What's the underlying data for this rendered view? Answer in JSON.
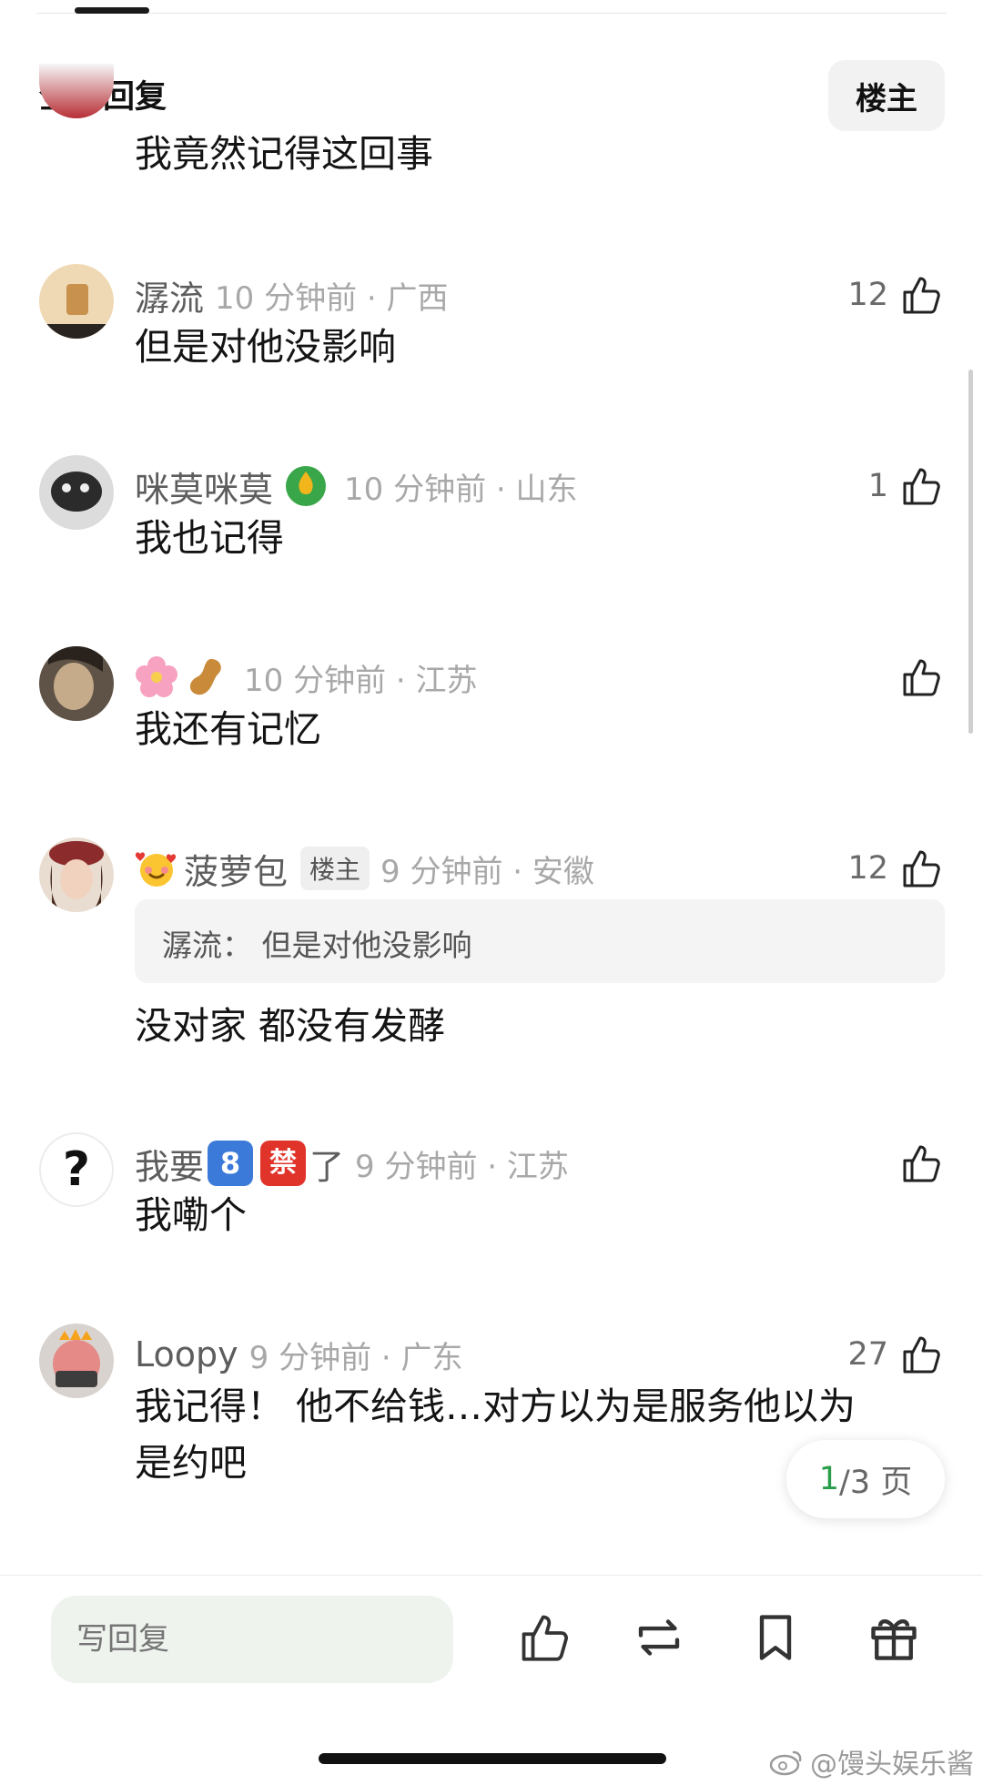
{
  "header": {
    "title": "全部回复",
    "op_button": "楼主"
  },
  "comments": [
    {
      "content": "我竟然记得这回事"
    },
    {
      "username": "潺流",
      "time": "10 分钟前 · 广西",
      "likes": "12",
      "content": "但是对他没影响"
    },
    {
      "username": "咪莫咪莫",
      "time": "10 分钟前 · 山东",
      "likes": "1",
      "content": "我也记得"
    },
    {
      "username": "",
      "time": "10 分钟前 · 江苏",
      "likes": "",
      "content": "我还有记忆"
    },
    {
      "username": "菠萝包",
      "badge": "楼主",
      "time": "9 分钟前 · 安徽",
      "likes": "12",
      "quote": "潺流：  但是对他没影响",
      "content": "没对家 都没有发酵"
    },
    {
      "username_prefix": "我要",
      "badge1": "8",
      "badge2": "禁",
      "username_suffix": "了",
      "time": "9 分钟前 · 江苏",
      "likes": "",
      "content": "我嘞个"
    },
    {
      "username": "Loopy",
      "time": "9 分钟前 · 广东",
      "likes": "27",
      "content_line1": "我记得！ 他不给钱…对方以为是服务他以为",
      "content_line2": "是约吧"
    }
  ],
  "pager": {
    "current": "1",
    "total": "/3 页"
  },
  "bottom_bar": {
    "reply_placeholder": "写回复"
  },
  "watermark": "@馒头娱乐酱",
  "colors": {
    "accent_green": "#2a9d4a",
    "text_gray": "#a8a8a8"
  }
}
